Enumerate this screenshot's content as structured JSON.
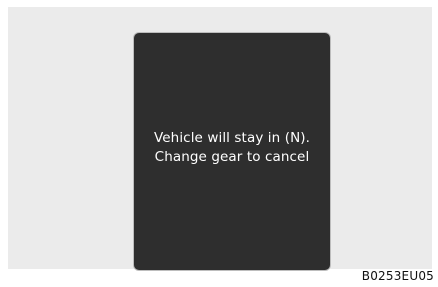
{
  "display": {
    "message_line1": "Vehicle will stay in (N).",
    "message_line2": "Change gear to cancel"
  },
  "figure_code": "B0253EU05",
  "colors": {
    "figure_background": "#ebebeb",
    "display_background": "#2e2e2e",
    "message_text": "#ffffff",
    "code_text": "#111111"
  }
}
